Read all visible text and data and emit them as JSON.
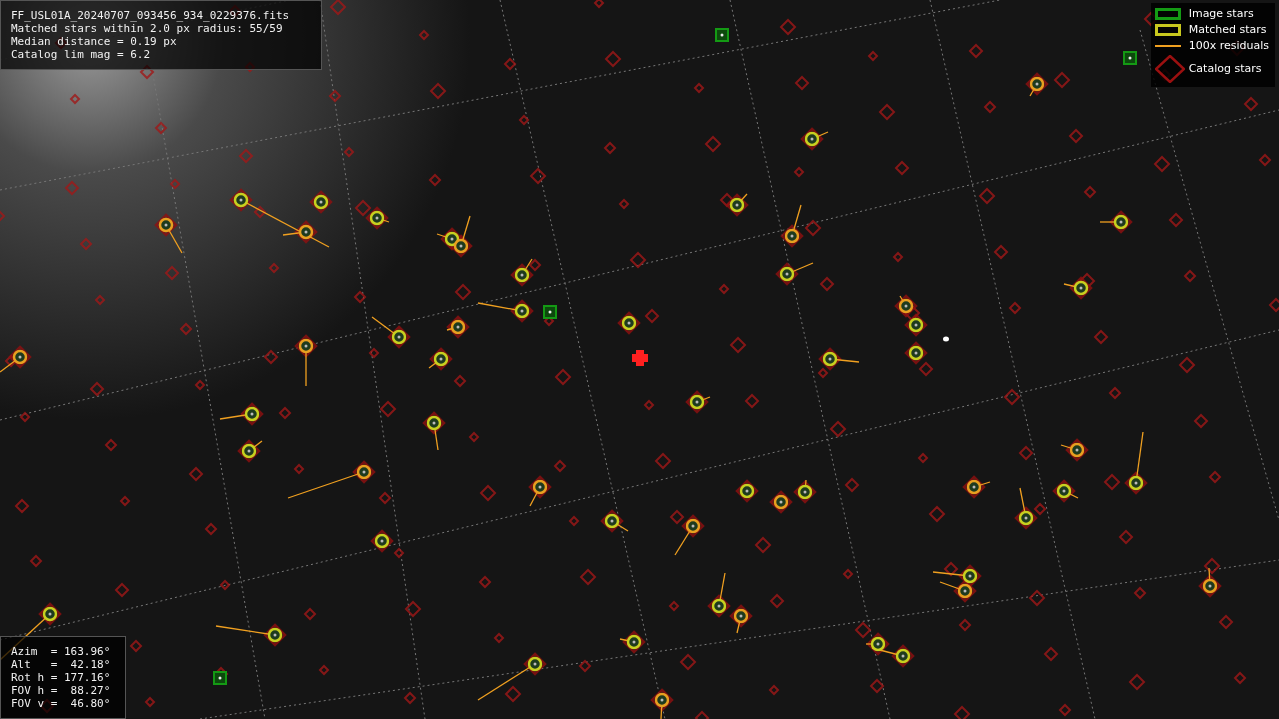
{
  "info_panel": {
    "lines": [
      "FF_USL01A_20240707_093456_934_0229376.fits",
      "Matched stars within 2.0 px radius: 55/59",
      "Median distance = 0.19 px",
      "Catalog lim mag = 6.2"
    ]
  },
  "legend": {
    "items": [
      {
        "kind": "image",
        "label": "Image stars"
      },
      {
        "kind": "matched",
        "label": "Matched stars"
      },
      {
        "kind": "residual",
        "label": "100x residuals"
      },
      {
        "kind": "catalog",
        "label": "Catalog stars"
      }
    ]
  },
  "pointing_panel": {
    "lines": [
      "Azim  = 163.96°",
      "Alt   =  42.18°",
      "Rot h = 177.16°",
      "FOV h =  88.27°",
      "FOV v =  46.80°"
    ]
  }
}
